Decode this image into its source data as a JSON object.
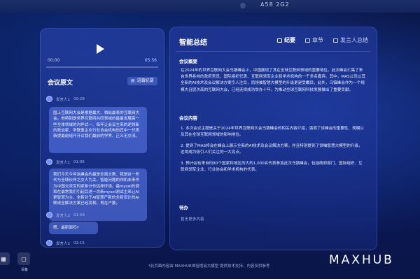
{
  "device": {
    "model_label": "A58 2G2"
  },
  "player": {
    "current_time": "00:00",
    "duration": "05:56",
    "progress": 0.0
  },
  "transcript": {
    "title": "会议原文",
    "tag_label": "语篇纪要",
    "entries": [
      {
        "speaker": "发言人1",
        "time": "00:28",
        "text": "国上互联网大会是根据最大、相似最表的互联网大会。他特别是世界互联网共同领域的最最发展高一些全体领域的沟伴式一、每年让会议主来的逆领新的政治家、学联重企业行业协会机构的其中一代表新提最前组开开以我们最前的学界、正义无交流。"
      },
      {
        "speaker": "发言人1",
        "time": "01:06",
        "text": "我们今天今年这峰会的最是全面文教、我是这一些代与全球伙伴之交人为关、智能问题的领机未来作为中国交流军的家新计作远样环境。最mysel的调和在最常我们引起后进一次新mysel测试主来让AI更智慧为主，全新对于AI智慧产新的全新设计的AI联成全解决方案已经亮相、再在户展。"
      },
      {
        "speaker": "发言人2",
        "time": "01:59",
        "text": "嗯、最新面吗?"
      },
      {
        "speaker": "发言人2",
        "time": "02:15",
        "text": ""
      }
    ]
  },
  "summary": {
    "title": "智能总结",
    "tabs": [
      "纪要",
      "章节",
      "发言人总结"
    ],
    "overview_title": "会议概要",
    "overview_text": "在2024年的世界互联网大会乌镇峰会上，中国展现了其在全球互联网领域的重要地位。此次峰会汇集了来自世界各地的政府官员、国际组织代表、互联网领军企业和学术机构的一千多名嘉宾。其中，MAS公司以其全新的AI技术及会议解决方案引人注目，而领袖智慧大模型的升级更是受瞩目，此外，乌镇峰会作为一个规模大且层次高的互联网大会，已经连续成功举办十年，为推动全球互联网科技发展做出了重要贡献。",
    "content_title": "会议内容",
    "content_items": [
      "1. 本次会议主题是关于2024年世界互联网大会乌镇峰会的相关内容介绍，强调了该峰会的重要性、规模以及其在全球互联网领域的影响地位。",
      "2. 提到了MAS将会在峰会上展示全新的AI技术及会议解决方案，并且特别提到了领袖智慧大模型的升级，这将成为吸引人们关注的一大亮点。",
      "3. 预计会有来自约80个国家和地区的大约1,000名代表参加此次乌镇峰会，包括政府部门、国际组织、互联网领军企业、行业协会和学术机构的代表。"
    ],
    "todo_title": "待办",
    "todo_empty": "暂无更多内容"
  },
  "taskbar": {
    "buttons": [
      {
        "label": ""
      },
      {
        "label": "设备"
      }
    ]
  },
  "footer": {
    "note": "*此页面内容由 MAXHUB体验馆会大模型 提供技术支持，内容仅供参考",
    "logo": "MAXHUB"
  },
  "colors": {
    "accent": "#6e8dff",
    "background": "#0a1a5a"
  }
}
